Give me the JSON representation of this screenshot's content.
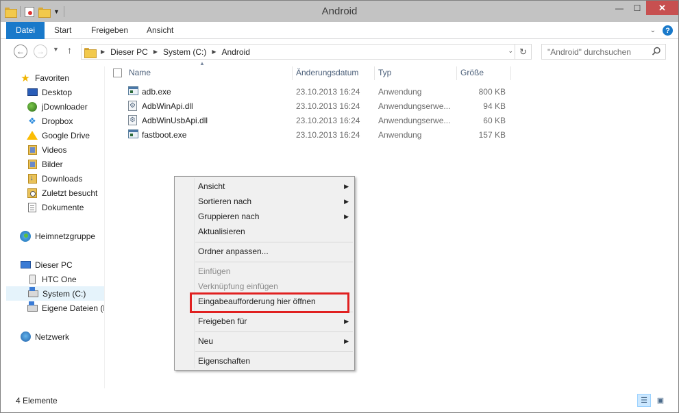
{
  "window": {
    "title": "Android",
    "close_glyph": "✕",
    "minimize_glyph": "—",
    "maximize_glyph": "☐"
  },
  "ribbon": {
    "tabs": [
      "Datei",
      "Start",
      "Freigeben",
      "Ansicht"
    ],
    "expand_glyph": "⌄",
    "help_glyph": "?"
  },
  "address": {
    "crumbs": [
      "Dieser PC",
      "System (C:)",
      "Android"
    ],
    "search_placeholder": "\"Android\" durchsuchen"
  },
  "sidebar": {
    "items": [
      {
        "label": "Favoriten",
        "icon": "star-icon"
      },
      {
        "label": "Desktop",
        "icon": "desktop-icon"
      },
      {
        "label": "jDownloader",
        "icon": "jdownloader-icon"
      },
      {
        "label": "Dropbox",
        "icon": "dropbox-icon"
      },
      {
        "label": "Google Drive",
        "icon": "google-drive-icon"
      },
      {
        "label": "Videos",
        "icon": "videos-library-icon"
      },
      {
        "label": "Bilder",
        "icon": "pictures-library-icon"
      },
      {
        "label": "Downloads",
        "icon": "downloads-folder-icon"
      },
      {
        "label": "Zuletzt besucht",
        "icon": "recent-places-icon"
      },
      {
        "label": "Dokumente",
        "icon": "documents-icon"
      },
      {
        "label": "Heimnetzgruppe",
        "icon": "homegroup-icon"
      },
      {
        "label": "Dieser PC",
        "icon": "this-pc-icon"
      },
      {
        "label": "HTC One",
        "icon": "phone-icon"
      },
      {
        "label": "System (C:)",
        "icon": "system-drive-icon"
      },
      {
        "label": "Eigene Dateien (D",
        "icon": "data-drive-icon"
      },
      {
        "label": "Netzwerk",
        "icon": "network-icon"
      }
    ]
  },
  "columns": {
    "name": "Name",
    "date": "Änderungsdatum",
    "type": "Typ",
    "size": "Größe"
  },
  "files": [
    {
      "name": "adb.exe",
      "date": "23.10.2013 16:24",
      "type": "Anwendung",
      "size": "800 KB",
      "kind": "exe"
    },
    {
      "name": "AdbWinApi.dll",
      "date": "23.10.2013 16:24",
      "type": "Anwendungserwe...",
      "size": "94 KB",
      "kind": "dll"
    },
    {
      "name": "AdbWinUsbApi.dll",
      "date": "23.10.2013 16:24",
      "type": "Anwendungserwe...",
      "size": "60 KB",
      "kind": "dll"
    },
    {
      "name": "fastboot.exe",
      "date": "23.10.2013 16:24",
      "type": "Anwendung",
      "size": "157 KB",
      "kind": "exe"
    }
  ],
  "context_menu": {
    "items": [
      {
        "label": "Ansicht",
        "submenu": true,
        "disabled": false
      },
      {
        "label": "Sortieren nach",
        "submenu": true,
        "disabled": false
      },
      {
        "label": "Gruppieren nach",
        "submenu": true,
        "disabled": false
      },
      {
        "label": "Aktualisieren",
        "submenu": false,
        "disabled": false
      },
      {
        "label": "Ordner anpassen...",
        "submenu": false,
        "disabled": false
      },
      {
        "label": "Einfügen",
        "submenu": false,
        "disabled": true
      },
      {
        "label": "Verknüpfung einfügen",
        "submenu": false,
        "disabled": true
      },
      {
        "label": "Eingabeaufforderung hier öffnen",
        "submenu": false,
        "disabled": false,
        "highlighted": true
      },
      {
        "label": "Freigeben für",
        "submenu": true,
        "disabled": false
      },
      {
        "label": "Neu",
        "submenu": true,
        "disabled": false
      },
      {
        "label": "Eigenschaften",
        "submenu": false,
        "disabled": false
      }
    ],
    "highlight_color": "#e02020",
    "submenu_glyph": "▶"
  },
  "status": {
    "item_count": "4 Elemente"
  },
  "colors": {
    "accent": "#1979ca",
    "titlebar": "#c3c3c3",
    "close": "#c75050"
  }
}
